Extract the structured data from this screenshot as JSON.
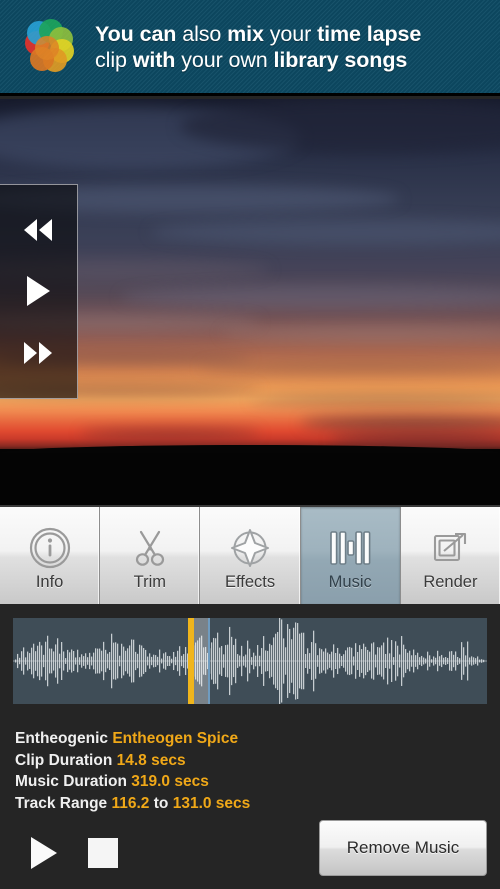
{
  "banner": {
    "logo_icon": "rainbow-petal-logo",
    "text_segments": [
      {
        "text": "You can ",
        "bold": true
      },
      {
        "text": "also ",
        "bold": false
      },
      {
        "text": "mix ",
        "bold": true
      },
      {
        "text": "your ",
        "bold": false
      },
      {
        "text": "time lapse",
        "bold": true
      }
    ],
    "text_segments_line2": [
      {
        "text": "clip ",
        "bold": false
      },
      {
        "text": "with ",
        "bold": true
      },
      {
        "text": "your own ",
        "bold": false
      },
      {
        "text": "library songs",
        "bold": true
      }
    ],
    "line1": "You can also mix your time lapse",
    "line2": "clip with your own library songs",
    "background_color": "#0d4a63"
  },
  "video": {
    "description": "sunset-time-lapse-preview",
    "controls": {
      "rewind_icon": "rewind-icon",
      "play_icon": "play-icon",
      "fast_forward_icon": "fast-forward-icon"
    }
  },
  "tabs": [
    {
      "id": "info",
      "label": "Info",
      "icon": "info-circle-icon",
      "active": false
    },
    {
      "id": "trim",
      "label": "Trim",
      "icon": "scissors-icon",
      "active": false
    },
    {
      "id": "effects",
      "label": "Effects",
      "icon": "compass-star-icon",
      "active": false
    },
    {
      "id": "music",
      "label": "Music",
      "icon": "equalizer-icon",
      "active": true
    },
    {
      "id": "render",
      "label": "Render",
      "icon": "export-box-icon",
      "active": false
    }
  ],
  "waveform": {
    "track_color": "#3f4d57",
    "bar_color": "#d3d8db",
    "playhead_color": "#f0b51c",
    "selection_border_color": "#6f9cc0",
    "playhead_percent": 37.0,
    "selection_start_percent": 37.5,
    "selection_end_percent": 41.5
  },
  "details": {
    "artist_label": "Entheogenic",
    "track_title": "Entheogen Spice",
    "clip_duration_label": "Clip Duration",
    "clip_duration_value": "14.8 secs",
    "music_duration_label": "Music Duration",
    "music_duration_value": "319.0 secs",
    "track_range_label": "Track Range",
    "track_range_start": "116.2",
    "track_range_to": "to",
    "track_range_end": "131.0 secs",
    "accent_color": "#f0a818"
  },
  "controls": {
    "play_icon": "play-icon",
    "stop_icon": "stop-icon",
    "remove_music_label": "Remove Music"
  }
}
